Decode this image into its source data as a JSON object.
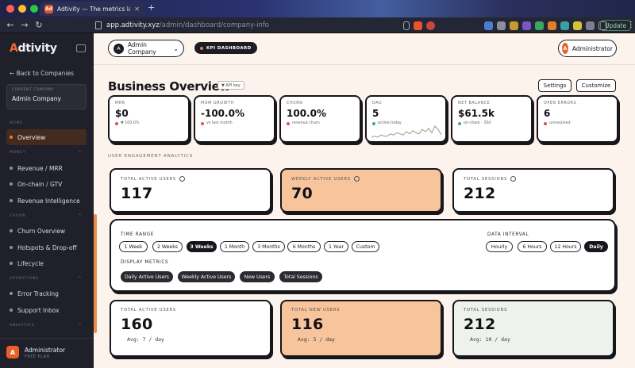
{
  "browser": {
    "tab_title": "Adtivity — The metrics layer f",
    "tab_favicon": "Ad",
    "url_host": "app.adtivity.xyz",
    "url_path": "/admin/dashboard/company-info",
    "update_label": "Update"
  },
  "sidebar": {
    "logo_prefix": "A",
    "logo_rest": "dtivity",
    "back_label": "← Back to Companies",
    "company_box_label": "CURRENT COMPANY",
    "company_box_value": "Admin Company",
    "sections": [
      {
        "title": "HOME",
        "items": [
          {
            "label": "Overview",
            "active": true
          }
        ]
      },
      {
        "title": "MONEY",
        "items": [
          {
            "label": "Revenue / MRR"
          },
          {
            "label": "On-chain / GTV"
          },
          {
            "label": "Revenue Intelligence"
          }
        ]
      },
      {
        "title": "CHURN",
        "items": [
          {
            "label": "Churn Overview"
          },
          {
            "label": "Hotspots & Drop-off"
          },
          {
            "label": "Lifecycle"
          }
        ]
      },
      {
        "title": "OPERATIONS",
        "items": [
          {
            "label": "Error Tracking"
          },
          {
            "label": "Support Inbox"
          }
        ]
      },
      {
        "title": "ANALYTICS",
        "items": []
      }
    ],
    "user_initial": "A",
    "user_name": "Administrator",
    "user_plan": "FREE PLAN"
  },
  "header": {
    "company_initial": "A",
    "company_name": "Admin Company",
    "kpi_label": "KPI DASHBOARD",
    "admin_initial": "A",
    "admin_label": "Administrator"
  },
  "page": {
    "title": "Business Overview",
    "api_key_label": "▼ API key",
    "settings_label": "Settings",
    "customize_label": "Customize"
  },
  "metrics": [
    {
      "label": "MRR",
      "value": "$0",
      "sub": "▼ 100.0%",
      "sub_color": "#d9534f"
    },
    {
      "label": "MOM GROWTH",
      "value": "-100.0%",
      "sub": "vs last month",
      "sub_color": "#d9534f"
    },
    {
      "label": "CHURN",
      "value": "100.0%",
      "sub": "revenue churn",
      "sub_color": "#d9534f"
    },
    {
      "label": "DAU",
      "value": "5",
      "sub": "active today",
      "sub_color": "#3fae6a"
    },
    {
      "label": "NET BALANCE",
      "value": "$61.5k",
      "sub": "on-chain · 30d",
      "sub_color": "#3fae6a"
    },
    {
      "label": "OPEN ERRORS",
      "value": "6",
      "sub": "unresolved",
      "sub_color": "#d9534f"
    }
  ],
  "dau_sparkline": [
    2,
    3,
    2,
    4,
    3,
    3,
    5,
    4,
    6,
    5,
    4,
    7,
    5,
    8,
    6,
    5,
    9,
    7,
    10,
    6,
    12,
    9,
    4
  ],
  "engagement": {
    "section_label": "USER ENGAGEMENT ANALYTICS",
    "cards": [
      {
        "label": "TOTAL ACTIVE USERS",
        "value": "117"
      },
      {
        "label": "WEEKLY ACTIVE USERS",
        "value": "70"
      },
      {
        "label": "TOTAL SESSIONS",
        "value": "212"
      }
    ]
  },
  "filters": {
    "time_range_label": "TIME RANGE",
    "time_ranges": [
      "1 Week",
      "2 Weeks",
      "3 Weeks",
      "1 Month",
      "3 Months",
      "6 Months",
      "1 Year",
      "Custom"
    ],
    "time_selected": "3 Weeks",
    "interval_label": "DATA INTERVAL",
    "intervals": [
      "Hourly",
      "6 Hours",
      "12 Hours",
      "Daily"
    ],
    "interval_selected": "Daily",
    "metrics_label": "DISPLAY METRICS",
    "display_metrics": [
      "Daily Active Users",
      "Weekly Active Users",
      "New Users",
      "Total Sessions"
    ]
  },
  "summary": [
    {
      "label": "TOTAL ACTIVE USERS",
      "value": "160",
      "avg": "Avg: 7 / day"
    },
    {
      "label": "TOTAL NEW USERS",
      "value": "116",
      "avg": "Avg: 5 / day"
    },
    {
      "label": "TOTAL SESSIONS",
      "value": "212",
      "avg": "Avg: 10 / day"
    }
  ],
  "colors": {
    "accent": "#f06a32",
    "card_orange": "#f8c49c",
    "bg": "#fbf3ec"
  }
}
